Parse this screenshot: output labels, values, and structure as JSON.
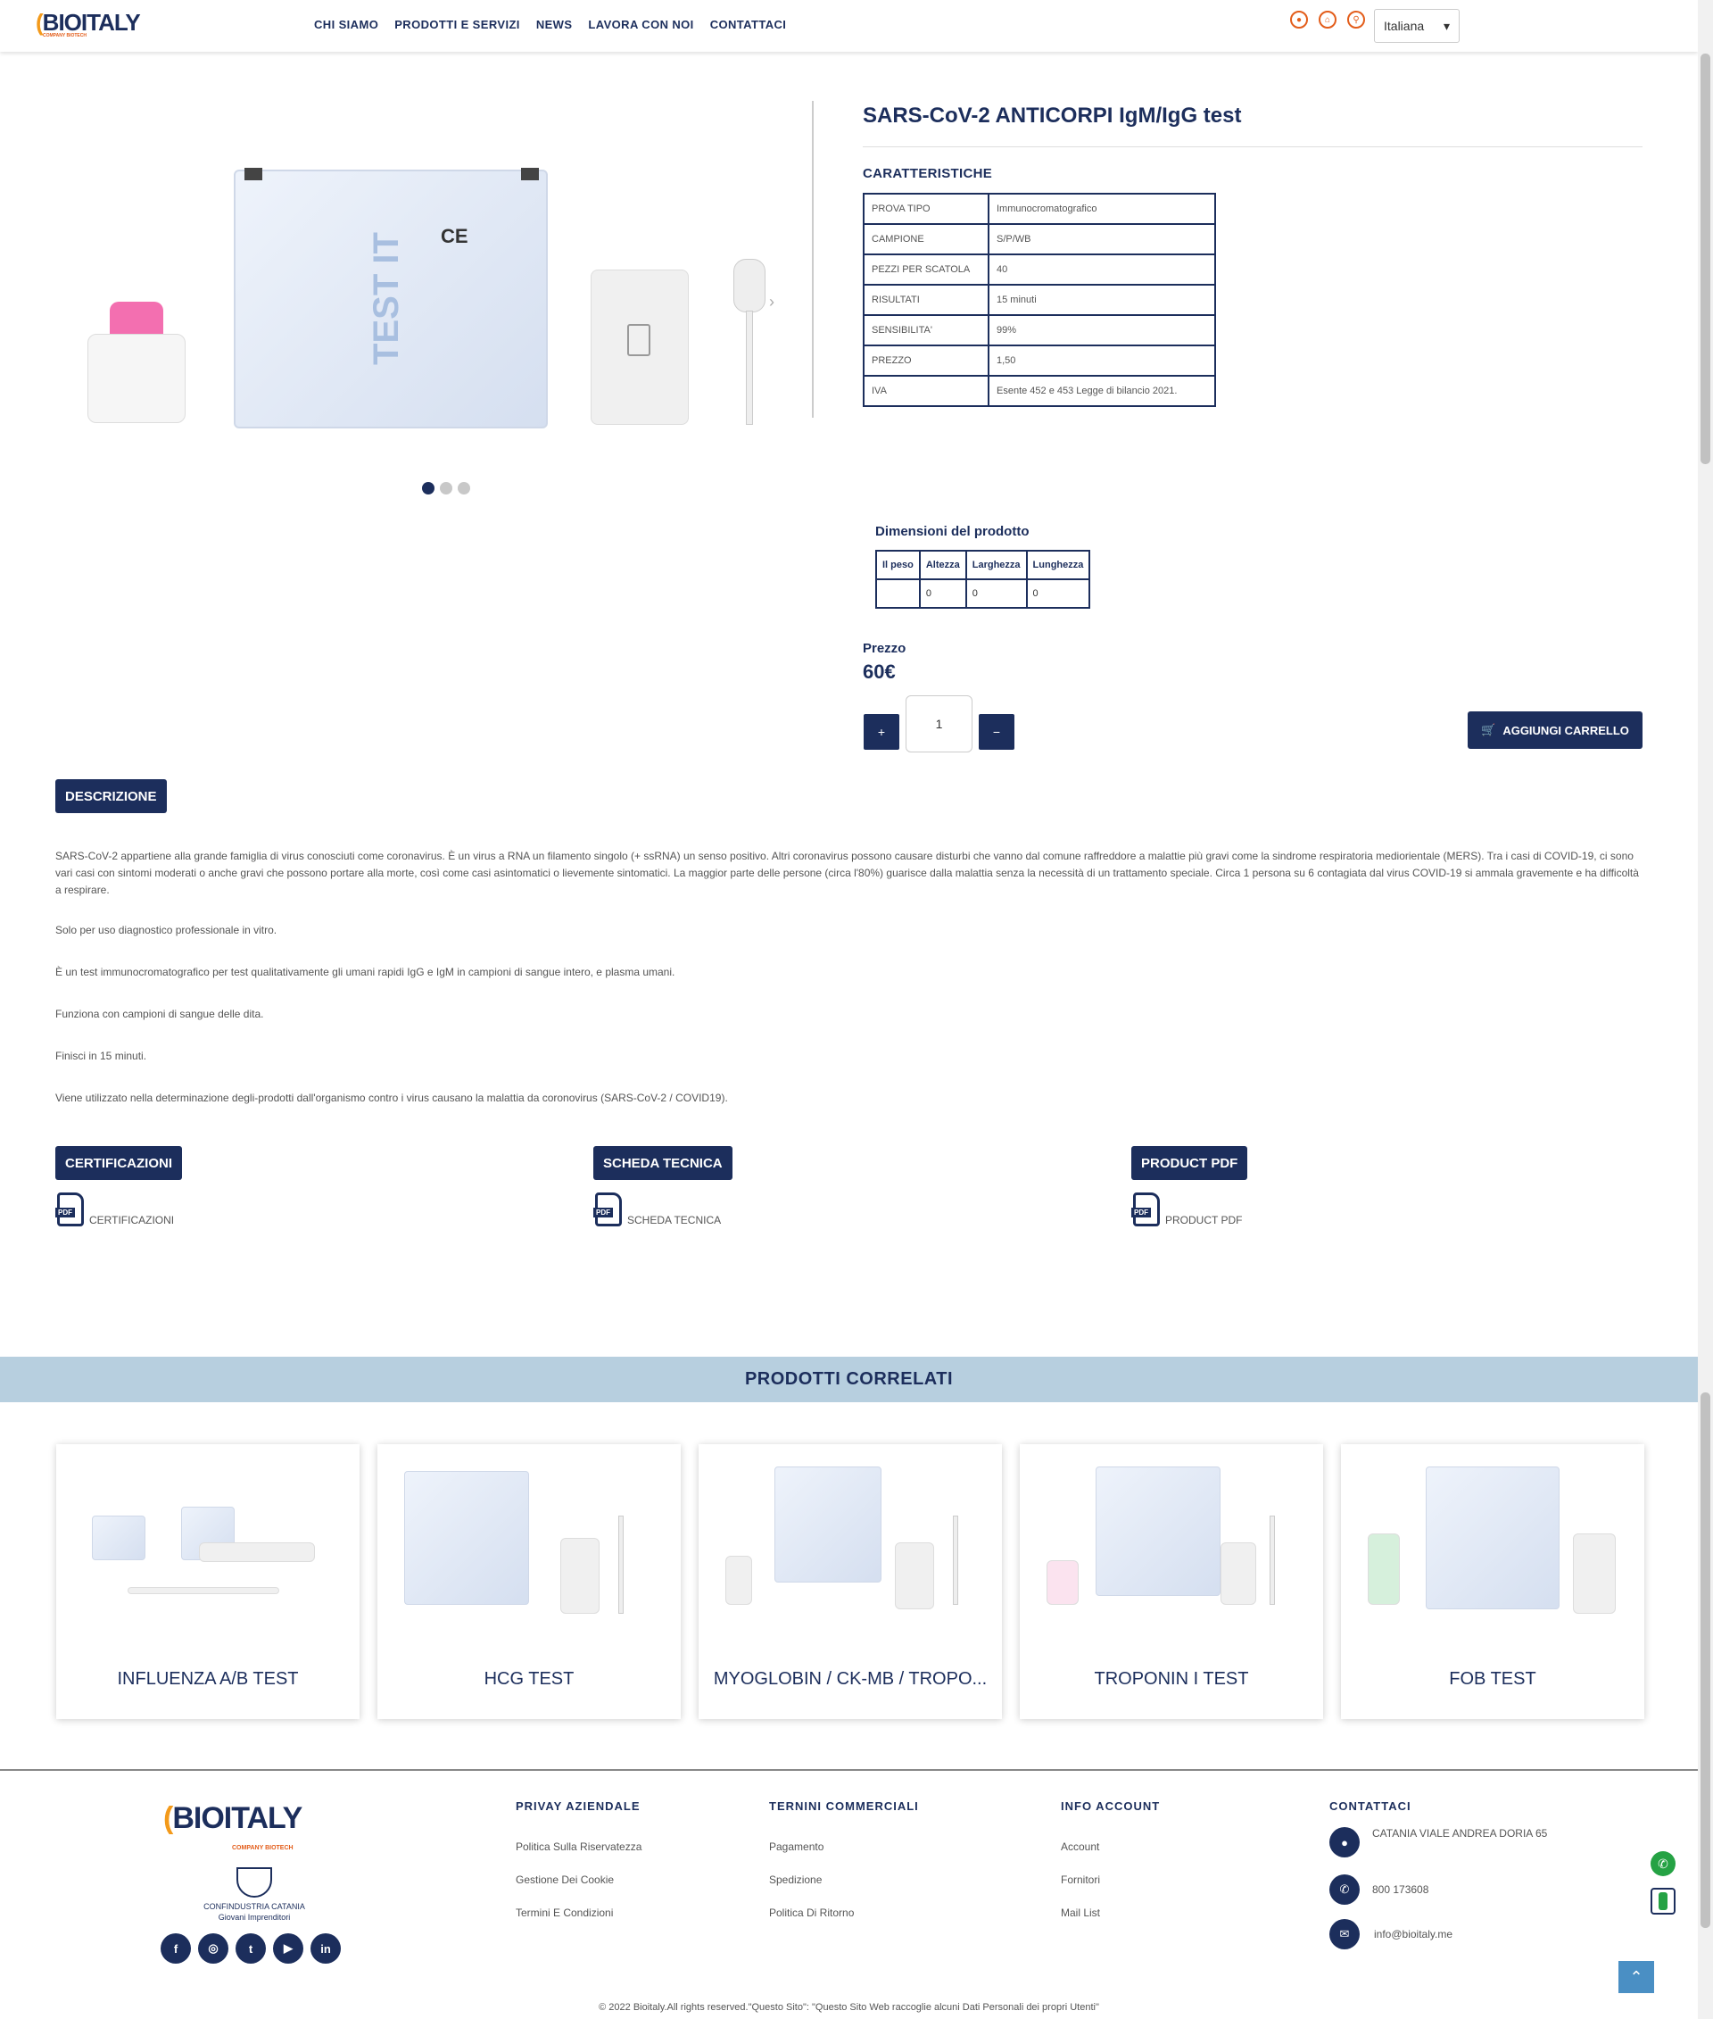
{
  "header": {
    "logo": "BIOITALY",
    "logo_sub": "COMPANY BIOTECH",
    "nav": [
      "CHI SIAMO",
      "PRODOTTI E SERVIZI",
      "NEWS",
      "LAVORA CON NOI",
      "CONTATTACI"
    ],
    "language": "Italiana",
    "icons": [
      "user-icon",
      "cart-icon",
      "search-icon"
    ]
  },
  "product": {
    "title": "SARS-CoV-2 ANTICORPI IgM/IgG test",
    "features_title": "CARATTERISTICHE",
    "specs": [
      {
        "key": "PROVA TIPO",
        "value": "Immunocromatografico"
      },
      {
        "key": "CAMPIONE",
        "value": "S/P/WB"
      },
      {
        "key": "PEZZI PER SCATOLA",
        "value": "40"
      },
      {
        "key": "RISULTATI",
        "value": "15 minuti"
      },
      {
        "key": "SENSIBILITA'",
        "value": "99%"
      },
      {
        "key": "PREZZO",
        "value": "1,50"
      },
      {
        "key": "IVA",
        "value": "Esente 452 e 453 Legge di bilancio 2021."
      }
    ],
    "dimensions_title": "Dimensioni del prodotto",
    "dimensions_headers": [
      "Il peso",
      "Altezza",
      "Larghezza",
      "Lunghezza"
    ],
    "dimensions_values": [
      "",
      "0",
      "0",
      "0"
    ],
    "price_label": "Prezzo",
    "price": "60€",
    "quantity": "1",
    "plus": "+",
    "minus": "−",
    "add_to_cart": "AGGIUNGI CARRELLO",
    "image_sachet_text": "TEST IT",
    "image_ce": "CE",
    "slider_active": 1,
    "slider_count": 3
  },
  "description": {
    "tab": "DESCRIZIONE",
    "paragraphs": [
      "SARS-CoV-2 appartiene alla grande famiglia di virus conosciuti come coronavirus. È un virus a RNA un filamento singolo (+ ssRNA) un senso positivo. Altri coronavirus possono causare disturbi che vanno dal comune raffreddore a malattie più gravi come la sindrome respiratoria mediorientale (MERS). Tra i casi di COVID-19, ci sono vari casi con sintomi moderati o anche gravi che possono portare alla morte, così come casi asintomatici o lievemente sintomatici. La maggior parte delle persone (circa l'80%) guarisce dalla malattia senza la necessità di un trattamento speciale. Circa 1 persona su 6 contagiata dal virus COVID-19 si ammala gravemente e ha difficoltà a respirare.",
      "Solo per uso diagnostico professionale in vitro.",
      "È un test immunocromatografico per test qualitativamente gli umani rapidi IgG e IgM in campioni di sangue intero, e plasma umani.",
      "Funziona con campioni di sangue delle dita.",
      "Finisci in 15 minuti.",
      "Viene utilizzato nella determinazione degli-prodotti dall'organismo contro i virus causano la malattia da coronovirus (SARS-CoV-2 / COVID19)."
    ]
  },
  "documents": [
    {
      "tab": "CERTIFICAZIONI",
      "link": "CERTIFICAZIONI"
    },
    {
      "tab": "SCHEDA TECNICA",
      "link": "SCHEDA TECNICA"
    },
    {
      "tab": "PRODUCT PDF",
      "link": "PRODUCT PDF"
    }
  ],
  "pdf_badge": "PDF",
  "related": {
    "title": "PRODOTTI CORRELATI",
    "items": [
      "INFLUENZA A/B TEST",
      "HCG TEST",
      "MYOGLOBIN / CK-MB / TROPO...",
      "TROPONIN I TEST",
      "FOB TEST"
    ]
  },
  "footer": {
    "logo": "BIOITALY",
    "logo_sub": "COMPANY BIOTECH",
    "confindustria": "CONFINDUSTRIA CATANIA",
    "confindustria_sub": "Giovani Imprenditori",
    "social": [
      "f",
      "◎",
      "t",
      "▶",
      "in"
    ],
    "columns": [
      {
        "title": "PRIVAY AZIENDALE",
        "links": [
          "Politica Sulla Riservatezza",
          "Gestione Dei Cookie",
          "Termini E Condizioni"
        ]
      },
      {
        "title": "TERNINI COMMERCIALI",
        "links": [
          "Pagamento",
          "Spedizione",
          "Politica Di Ritorno"
        ]
      },
      {
        "title": "INFO ACCOUNT",
        "links": [
          "Account",
          "Fornitori",
          "Mail List"
        ]
      }
    ],
    "contact_title": "CONTATTACI",
    "address": "CATANIA VIALE ANDREA DORIA 65",
    "phone": "800 173608",
    "email": "info@bioitaly.me",
    "copyright": "© 2022 Bioitaly.All rights reserved.\"Questo Sito\": \"Questo Sito Web raccoglie alcuni Dati Personali dei propri Utenti\""
  },
  "colors": {
    "primary": "#1c2e5c",
    "accent": "#e35d1a",
    "band": "#b7cfdf",
    "whatsapp": "#25a244"
  }
}
